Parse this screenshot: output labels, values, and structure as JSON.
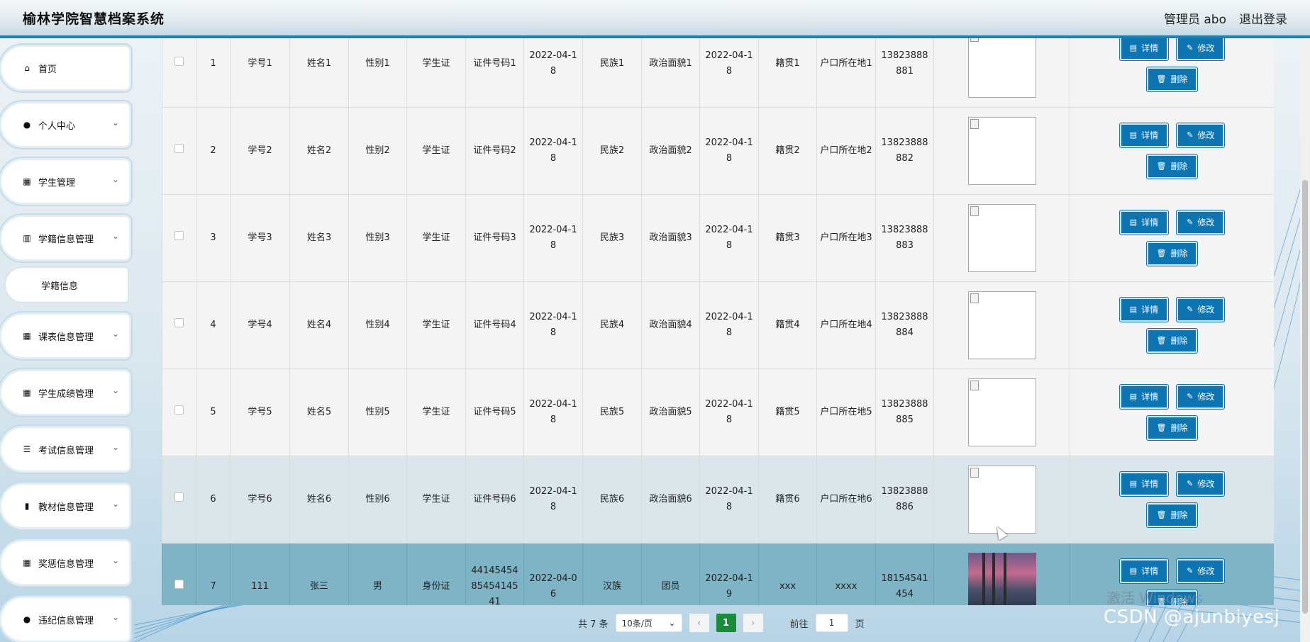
{
  "header": {
    "title": "榆林学院智慧档案系统",
    "user_label": "管理员 abo",
    "logout_label": "退出登录"
  },
  "sidebar": {
    "items": [
      {
        "label": "首页",
        "icon": "home-icon"
      },
      {
        "label": "个人中心",
        "icon": "user-icon"
      },
      {
        "label": "学生管理",
        "icon": "grid-icon"
      },
      {
        "label": "学籍信息管理",
        "icon": "book-icon"
      },
      {
        "label": "学籍信息",
        "icon": ""
      },
      {
        "label": "课表信息管理",
        "icon": "grid-icon"
      },
      {
        "label": "学生成绩管理",
        "icon": "grid-icon"
      },
      {
        "label": "考试信息管理",
        "icon": "sliders-icon"
      },
      {
        "label": "教材信息管理",
        "icon": "bar-chart-icon"
      },
      {
        "label": "奖惩信息管理",
        "icon": "grid-icon"
      },
      {
        "label": "违纪信息管理",
        "icon": "user-icon"
      }
    ]
  },
  "table": {
    "rows": [
      {
        "idx": "1",
        "xh": "学号1",
        "xm": "姓名1",
        "xb": "性别1",
        "zj": "学生证",
        "zjhm": "证件号码1",
        "d1": "2022-04-18",
        "mz": "民族1",
        "zzmm": "政治面貌1",
        "d2": "2022-04-18",
        "jg": "籍贯1",
        "hk": "户口所在地1",
        "tel": "13823888881"
      },
      {
        "idx": "2",
        "xh": "学号2",
        "xm": "姓名2",
        "xb": "性别2",
        "zj": "学生证",
        "zjhm": "证件号码2",
        "d1": "2022-04-18",
        "mz": "民族2",
        "zzmm": "政治面貌2",
        "d2": "2022-04-18",
        "jg": "籍贯2",
        "hk": "户口所在地2",
        "tel": "13823888882"
      },
      {
        "idx": "3",
        "xh": "学号3",
        "xm": "姓名3",
        "xb": "性别3",
        "zj": "学生证",
        "zjhm": "证件号码3",
        "d1": "2022-04-18",
        "mz": "民族3",
        "zzmm": "政治面貌3",
        "d2": "2022-04-18",
        "jg": "籍贯3",
        "hk": "户口所在地3",
        "tel": "13823888883"
      },
      {
        "idx": "4",
        "xh": "学号4",
        "xm": "姓名4",
        "xb": "性别4",
        "zj": "学生证",
        "zjhm": "证件号码4",
        "d1": "2022-04-18",
        "mz": "民族4",
        "zzmm": "政治面貌4",
        "d2": "2022-04-18",
        "jg": "籍贯4",
        "hk": "户口所在地4",
        "tel": "13823888884"
      },
      {
        "idx": "5",
        "xh": "学号5",
        "xm": "姓名5",
        "xb": "性别5",
        "zj": "学生证",
        "zjhm": "证件号码5",
        "d1": "2022-04-18",
        "mz": "民族5",
        "zzmm": "政治面貌5",
        "d2": "2022-04-18",
        "jg": "籍贯5",
        "hk": "户口所在地5",
        "tel": "13823888885"
      },
      {
        "idx": "6",
        "xh": "学号6",
        "xm": "姓名6",
        "xb": "性别6",
        "zj": "学生证",
        "zjhm": "证件号码6",
        "d1": "2022-04-18",
        "mz": "民族6",
        "zzmm": "政治面貌6",
        "d2": "2022-04-18",
        "jg": "籍贯6",
        "hk": "户口所在地6",
        "tel": "13823888886"
      },
      {
        "idx": "7",
        "xh": "111",
        "xm": "张三",
        "xb": "男",
        "zj": "身份证",
        "zjhm": "441454548545414541",
        "d1": "2022-04-06",
        "mz": "汉族",
        "zzmm": "团员",
        "d2": "2022-04-19",
        "jg": "xxx",
        "hk": "xxxx",
        "tel": "18154541454"
      }
    ],
    "actions": {
      "detail": "详情",
      "edit": "修改",
      "delete": "删除"
    }
  },
  "pager": {
    "total": "共 7 条",
    "page_size": "10条/页",
    "current": "1",
    "goto_label": "前往",
    "goto_value": "1",
    "page_unit": "页"
  },
  "watermark": {
    "windows": "激活 Windows",
    "csdn": "CSDN @ajunbiyesj"
  },
  "colors": {
    "accent": "#0e75b3",
    "header_border": "#1f7fae",
    "page_active": "#1a8a3c",
    "row_highlight": "#7fb3c6"
  }
}
